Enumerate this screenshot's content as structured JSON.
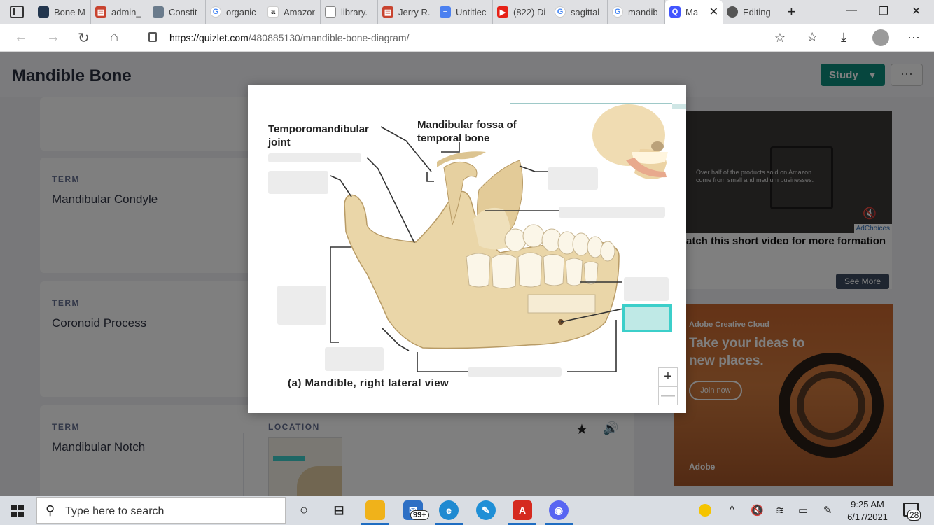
{
  "browser": {
    "tabs": [
      {
        "title": "Bone M",
        "favicon": "bone-favicon",
        "color": "#23364e"
      },
      {
        "title": "admin_",
        "favicon": "pdf-favicon",
        "color": "#c8432f"
      },
      {
        "title": "Constit",
        "favicon": "constitution-favicon",
        "color": "#6a7b8c"
      },
      {
        "title": "organic",
        "favicon": "google-favicon",
        "color": "#4285f4"
      },
      {
        "title": "Amazor",
        "favicon": "amazon-favicon",
        "color": "#444444"
      },
      {
        "title": "library.",
        "favicon": "document-favicon",
        "color": "#7f8a99"
      },
      {
        "title": "Jerry R.",
        "favicon": "pdf-favicon",
        "color": "#c8432f"
      },
      {
        "title": "Untitlec",
        "favicon": "docs-favicon",
        "color": "#4b80f0"
      },
      {
        "title": "(822) Di",
        "favicon": "youtube-favicon",
        "color": "#e62117"
      },
      {
        "title": "sagittal",
        "favicon": "google-favicon",
        "color": "#4285f4"
      },
      {
        "title": "mandib",
        "favicon": "google-favicon",
        "color": "#4285f4"
      },
      {
        "title": "Ma",
        "favicon": "quizlet-favicon",
        "color": "#4255ff",
        "active": true
      },
      {
        "title": "Editing",
        "favicon": "editing-favicon",
        "color": "#555555"
      }
    ],
    "url_host": "https://quizlet.com",
    "url_path": "/480885130/mandible-bone-diagram/"
  },
  "page": {
    "title": "Mandible Bone",
    "study_label": "Study",
    "more_label": "···"
  },
  "cards": [
    {
      "term_label": "TERM",
      "term": "Mandibular Condyle"
    },
    {
      "term_label": "TERM",
      "term": "Coronoid Process"
    },
    {
      "term_label": "TERM",
      "term": "Mandibular Notch",
      "location_label": "LOCATION"
    }
  ],
  "ads": {
    "video_text": "Over half of the products sold on Amazon come from small and medium businesses.",
    "adchoices": "AdChoices",
    "video_headline": "atch this short video for more formation",
    "see_more": "See More",
    "adobe_brand": "Adobe Creative Cloud",
    "adobe_headline": "Take your ideas to new places.",
    "adobe_join": "Join now",
    "adobe_logo": "Adobe"
  },
  "diagram": {
    "label_tmj": "Temporomandibular joint",
    "label_fossa": "Mandibular fossa of temporal bone",
    "caption": "(a) Mandible, right lateral view",
    "zoom_in": "+",
    "zoom_out": "—",
    "active_blank_color": "#3ccfca"
  },
  "taskbar": {
    "search_placeholder": "Type here to search",
    "mail_badge": "99+",
    "time": "9:25 AM",
    "date": "6/17/2021",
    "notifications": "28"
  }
}
